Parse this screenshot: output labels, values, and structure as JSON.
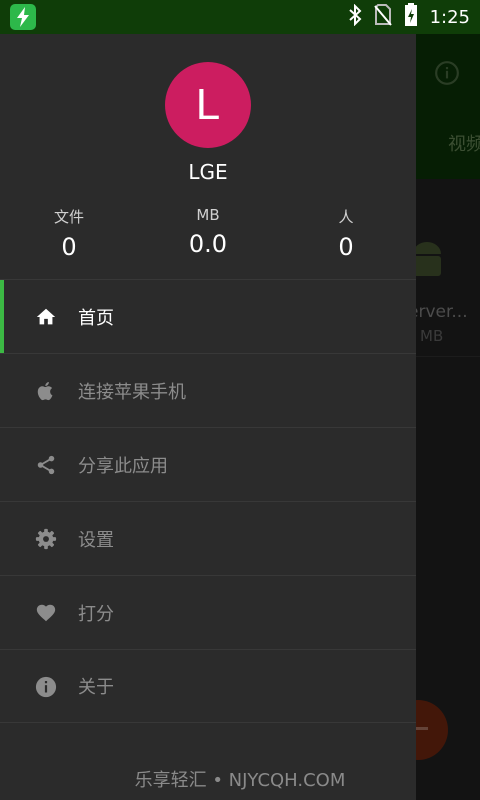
{
  "status_bar": {
    "time": "1:25",
    "icons": [
      "charging-app-icon",
      "bluetooth-icon",
      "no-sim-icon",
      "battery-charging-icon"
    ]
  },
  "background": {
    "tab_label": "视频",
    "file_name": "erver...",
    "file_size": "MB"
  },
  "drawer": {
    "avatar_letter": "L",
    "user_name": "LGE",
    "stats": [
      {
        "label": "文件",
        "value": "0"
      },
      {
        "label": "MB",
        "value": "0.0"
      },
      {
        "label": "人",
        "value": "0"
      }
    ],
    "menu": [
      {
        "label": "首页",
        "icon": "home-icon",
        "active": true
      },
      {
        "label": "连接苹果手机",
        "icon": "apple-icon",
        "active": false
      },
      {
        "label": "分享此应用",
        "icon": "share-icon",
        "active": false
      },
      {
        "label": "设置",
        "icon": "gear-icon",
        "active": false
      },
      {
        "label": "打分",
        "icon": "heart-icon",
        "active": false
      },
      {
        "label": "关于",
        "icon": "info-icon",
        "active": false
      }
    ]
  },
  "watermark": "乐享轻汇 • NJYCQH.COM",
  "colors": {
    "status_bar": "#0f3d08",
    "drawer": "#2b2b2b",
    "avatar": "#cc1d60",
    "active_indicator": "#3cb944",
    "fab": "#7a2a12"
  }
}
